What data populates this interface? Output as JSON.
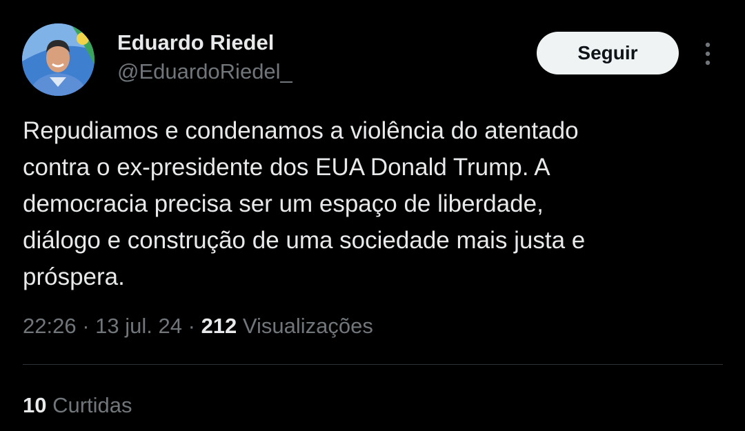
{
  "author": {
    "display_name": "Eduardo Riedel",
    "handle": "@EduardoRiedel_"
  },
  "follow_button": {
    "label": "Seguir"
  },
  "more_options": {
    "icon": "more-vertical-icon"
  },
  "tweet": {
    "text_lines": [
      "Repudiamos e condenamos a violência do atentado",
      "contra o ex-presidente dos EUA Donald Trump. A",
      "democracia precisa ser um espaço de liberdade,",
      "diálogo e construção de uma sociedade mais justa e",
      "próspera."
    ]
  },
  "meta": {
    "time": "22:26",
    "separator": "·",
    "date": "13 jul. 24",
    "views_count": "212",
    "views_label": "Visualizações"
  },
  "engagement": {
    "likes_count": "10",
    "likes_label": "Curtidas"
  },
  "colors": {
    "background": "#000000",
    "primary_text": "#e7e9ea",
    "secondary_text": "#71767b",
    "button_bg": "#eff3f4",
    "divider": "#2f3336"
  }
}
